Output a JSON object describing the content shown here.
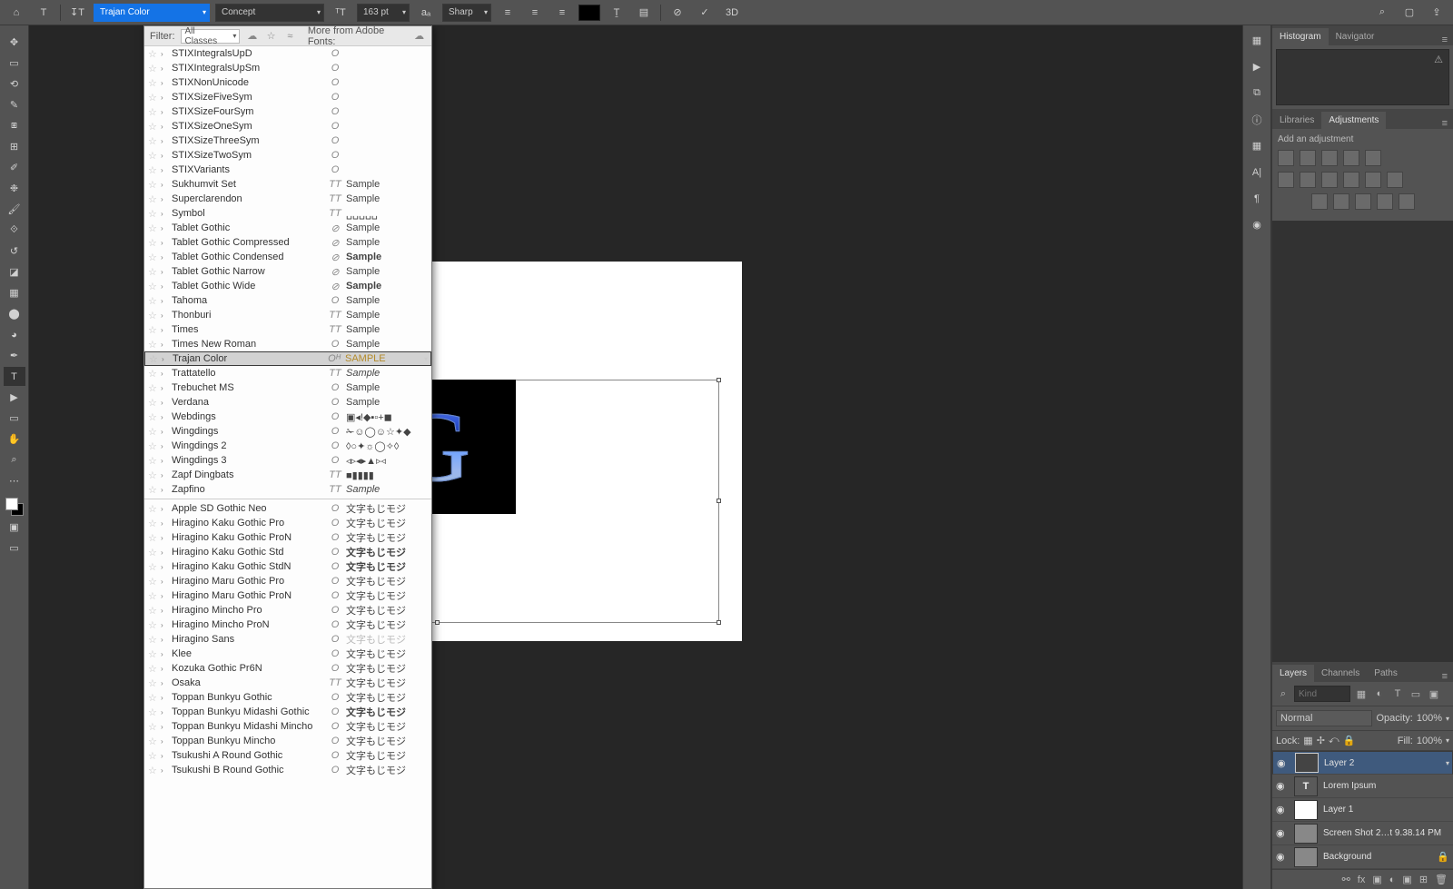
{
  "topbar": {
    "font_family": "Trajan Color",
    "font_style": "Concept",
    "font_size": "163 pt",
    "aa_mode": "Sharp"
  },
  "font_popup": {
    "filter_label": "Filter:",
    "filter_value": "All Classes",
    "more_label": "More from Adobe Fonts:",
    "fonts_top": [
      {
        "name": "STIXIntegralsUpD",
        "kind": "O",
        "sample": ""
      },
      {
        "name": "STIXIntegralsUpSm",
        "kind": "O",
        "sample": ""
      },
      {
        "name": "STIXNonUnicode",
        "kind": "O",
        "sample": ""
      },
      {
        "name": "STIXSizeFiveSym",
        "kind": "O",
        "sample": ""
      },
      {
        "name": "STIXSizeFourSym",
        "kind": "O",
        "sample": ""
      },
      {
        "name": "STIXSizeOneSym",
        "kind": "O",
        "sample": ""
      },
      {
        "name": "STIXSizeThreeSym",
        "kind": "O",
        "sample": ""
      },
      {
        "name": "STIXSizeTwoSym",
        "kind": "O",
        "sample": ""
      },
      {
        "name": "STIXVariants",
        "kind": "O",
        "sample": ""
      },
      {
        "name": "Sukhumvit Set",
        "kind": "TT",
        "sample": "Sample"
      },
      {
        "name": "Superclarendon",
        "kind": "TT",
        "sample": "Sample"
      },
      {
        "name": "Symbol",
        "kind": "TT",
        "sample": "␣␣␣␣␣"
      },
      {
        "name": "Tablet Gothic",
        "kind": "⊘",
        "sample": "Sample"
      },
      {
        "name": "Tablet Gothic Compressed",
        "kind": "⊘",
        "sample": "Sample"
      },
      {
        "name": "Tablet Gothic Condensed",
        "kind": "⊘",
        "sample": "Sample",
        "bold": true
      },
      {
        "name": "Tablet Gothic Narrow",
        "kind": "⊘",
        "sample": "Sample"
      },
      {
        "name": "Tablet Gothic Wide",
        "kind": "⊘",
        "sample": "Sample",
        "bold": true
      },
      {
        "name": "Tahoma",
        "kind": "O",
        "sample": "Sample"
      },
      {
        "name": "Thonburi",
        "kind": "TT",
        "sample": "Sample"
      },
      {
        "name": "Times",
        "kind": "TT",
        "sample": "Sample"
      },
      {
        "name": "Times New Roman",
        "kind": "O",
        "sample": "Sample"
      },
      {
        "name": "Trajan Color",
        "kind": "Oᴴ",
        "sample": "SAMPLE",
        "sel": true,
        "gold": true
      },
      {
        "name": "Trattatello",
        "kind": "TT",
        "sample": "Sample",
        "ital": true
      },
      {
        "name": "Trebuchet MS",
        "kind": "O",
        "sample": "Sample"
      },
      {
        "name": "Verdana",
        "kind": "O",
        "sample": "Sample"
      },
      {
        "name": "Webdings",
        "kind": "O",
        "sample": "▣◂!◆▪▫+◼"
      },
      {
        "name": "Wingdings",
        "kind": "O",
        "sample": "✁☺◯☺☆✦◆"
      },
      {
        "name": "Wingdings 2",
        "kind": "O",
        "sample": "◊○✦☼◯✧◊"
      },
      {
        "name": "Wingdings 3",
        "kind": "O",
        "sample": "◃▹◂▸▲▹◃"
      },
      {
        "name": "Zapf Dingbats",
        "kind": "TT",
        "sample": "■▮▮▮▮"
      },
      {
        "name": "Zapfino",
        "kind": "TT",
        "sample": "Sample",
        "ital": true
      }
    ],
    "fonts_cjk": [
      {
        "name": "Apple SD Gothic Neo",
        "kind": "O",
        "sample": "文字もじモジ"
      },
      {
        "name": "Hiragino Kaku Gothic Pro",
        "kind": "O",
        "sample": "文字もじモジ"
      },
      {
        "name": "Hiragino Kaku Gothic ProN",
        "kind": "O",
        "sample": "文字もじモジ"
      },
      {
        "name": "Hiragino Kaku Gothic Std",
        "kind": "O",
        "sample": "文字もじモジ",
        "bold": true
      },
      {
        "name": "Hiragino Kaku Gothic StdN",
        "kind": "O",
        "sample": "文字もじモジ",
        "bold": true
      },
      {
        "name": "Hiragino Maru Gothic Pro",
        "kind": "O",
        "sample": "文字もじモジ"
      },
      {
        "name": "Hiragino Maru Gothic ProN",
        "kind": "O",
        "sample": "文字もじモジ"
      },
      {
        "name": "Hiragino Mincho Pro",
        "kind": "O",
        "sample": "文字もじモジ"
      },
      {
        "name": "Hiragino Mincho ProN",
        "kind": "O",
        "sample": "文字もじモジ"
      },
      {
        "name": "Hiragino Sans",
        "kind": "O",
        "sample": "文字もじモジ",
        "light": true
      },
      {
        "name": "Klee",
        "kind": "O",
        "sample": "文字もじモジ"
      },
      {
        "name": "Kozuka Gothic Pr6N",
        "kind": "O",
        "sample": "文字もじモジ"
      },
      {
        "name": "Osaka",
        "kind": "TT",
        "sample": "文字もじモジ"
      },
      {
        "name": "Toppan Bunkyu Gothic",
        "kind": "O",
        "sample": "文字もじモジ"
      },
      {
        "name": "Toppan Bunkyu Midashi Gothic",
        "kind": "O",
        "sample": "文字もじモジ",
        "bold": true
      },
      {
        "name": "Toppan Bunkyu Midashi Mincho",
        "kind": "O",
        "sample": "文字もじモジ"
      },
      {
        "name": "Toppan Bunkyu Mincho",
        "kind": "O",
        "sample": "文字もじモジ"
      },
      {
        "name": "Tsukushi A Round Gothic",
        "kind": "O",
        "sample": "文字もじモジ"
      },
      {
        "name": "Tsukushi B Round Gothic",
        "kind": "O",
        "sample": "文字もじモジ"
      }
    ]
  },
  "canvas_text": "SVG",
  "panels": {
    "hist_tab": "Histogram",
    "nav_tab": "Navigator",
    "lib_tab": "Libraries",
    "adj_tab": "Adjustments",
    "adj_label": "Add an adjustment",
    "layers_tab": "Layers",
    "channels_tab": "Channels",
    "paths_tab": "Paths",
    "kind_placeholder": "Kind",
    "blend_mode": "Normal",
    "opacity_label": "Opacity:",
    "opacity_value": "100%",
    "lock_label": "Lock:",
    "fill_label": "Fill:",
    "fill_value": "100%",
    "layers": [
      {
        "name": "Layer 2",
        "thumb": "frame",
        "sel": true
      },
      {
        "name": "Lorem Ipsum",
        "thumb": "T"
      },
      {
        "name": "Layer 1",
        "thumb": "white"
      },
      {
        "name": "Screen Shot 2…t 9.38.14 PM",
        "thumb": "img"
      },
      {
        "name": "Background",
        "thumb": "img",
        "locked": true
      }
    ]
  }
}
